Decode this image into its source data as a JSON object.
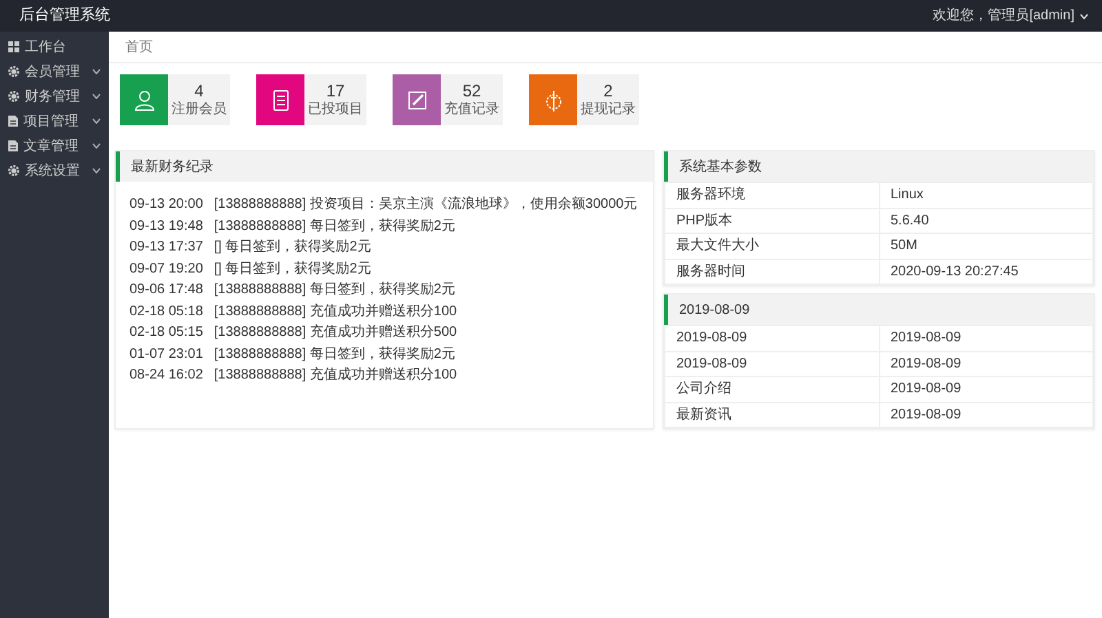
{
  "header": {
    "title": "后台管理系统",
    "user_menu": "欢迎您，管理员[admin]"
  },
  "sidebar": {
    "items": [
      {
        "label": "工作台",
        "kind": "dashboard",
        "expandable": false
      },
      {
        "label": "会员管理",
        "kind": "menu",
        "expandable": true
      },
      {
        "label": "财务管理",
        "kind": "menu",
        "expandable": true
      },
      {
        "label": "项目管理",
        "kind": "document",
        "expandable": true
      },
      {
        "label": "文章管理",
        "kind": "document",
        "expandable": true
      },
      {
        "label": "系统设置",
        "kind": "menu",
        "expandable": true
      }
    ]
  },
  "breadcrumb": "首页",
  "stats": [
    {
      "value": "4",
      "label": "注册会员",
      "kind": "user",
      "color": "#16a04f"
    },
    {
      "value": "17",
      "label": "已投项目",
      "kind": "list",
      "color": "#e2067f"
    },
    {
      "value": "52",
      "label": "充值记录",
      "kind": "edit",
      "color": "#ab5ea5"
    },
    {
      "value": "2",
      "label": "提现记录",
      "kind": "withdraw",
      "color": "#e8690f"
    }
  ],
  "records": {
    "title": "最新财务纪录",
    "rows": [
      {
        "time": "09-13 20:00",
        "text": "[13888888888] 投资项目：吴京主演《流浪地球》，使用余额30000元"
      },
      {
        "time": "09-13 19:48",
        "text": "[13888888888] 每日签到，获得奖励2元"
      },
      {
        "time": "09-13 17:37",
        "text": "[] 每日签到，获得奖励2元"
      },
      {
        "time": "09-07 19:20",
        "text": "[] 每日签到，获得奖励2元"
      },
      {
        "time": "09-06 17:48",
        "text": "[13888888888] 每日签到，获得奖励2元"
      },
      {
        "time": "02-18 05:18",
        "text": "[13888888888] 充值成功并赠送积分100"
      },
      {
        "time": "02-18 05:15",
        "text": "[13888888888] 充值成功并赠送积分500"
      },
      {
        "time": "01-07 23:01",
        "text": "[13888888888] 每日签到，获得奖励2元"
      },
      {
        "time": "08-24 16:02",
        "text": "[13888888888] 充值成功并赠送积分100"
      }
    ]
  },
  "system": {
    "title": "系统基本参数",
    "rows": [
      {
        "name": "服务器环境",
        "value": "Linux"
      },
      {
        "name": "PHP版本",
        "value": "5.6.40"
      },
      {
        "name": "最大文件大小",
        "value": "50M"
      },
      {
        "name": "服务器时间",
        "value": "2020-09-13 20:27:45"
      }
    ]
  },
  "articles": {
    "title": "2019-08-09",
    "rows": [
      {
        "name": "2019-08-09",
        "value": "2019-08-09"
      },
      {
        "name": "2019-08-09",
        "value": "2019-08-09"
      },
      {
        "name": "公司介绍",
        "value": "2019-08-09"
      },
      {
        "name": "最新资讯",
        "value": "2019-08-09"
      }
    ]
  }
}
